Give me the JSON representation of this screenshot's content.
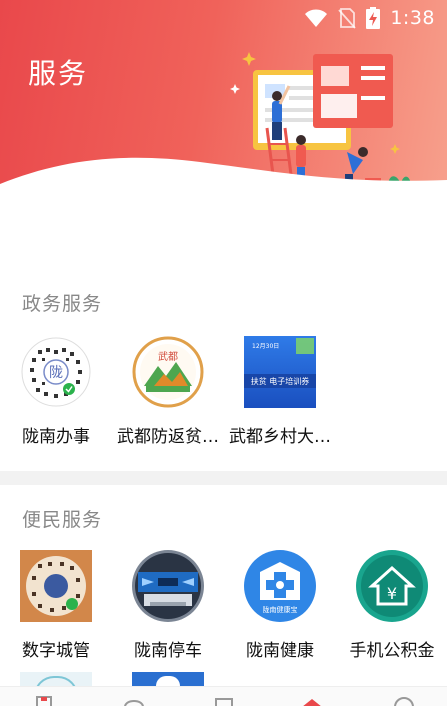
{
  "status_bar": {
    "time": "1:38"
  },
  "header": {
    "title": "服务"
  },
  "sections": [
    {
      "title": "政务服务",
      "items": [
        {
          "label": "陇南办事",
          "icon": "qr-code-icon"
        },
        {
          "label": "武都防返贫…",
          "icon": "mountain-logo-icon",
          "badge": "武都"
        },
        {
          "label": "武都乡村大…",
          "icon": "training-banner-icon",
          "banner_text": "扶贫 电子培训券",
          "banner_date": "12月30日"
        }
      ]
    },
    {
      "title": "便民服务",
      "items": [
        {
          "label": "数字城管",
          "icon": "qr-code-orange-icon"
        },
        {
          "label": "陇南停车",
          "icon": "parking-icon"
        },
        {
          "label": "陇南健康",
          "icon": "health-icon",
          "caption": "陇南健康宝"
        },
        {
          "label": "手机公积金",
          "icon": "housing-fund-icon",
          "symbol": "¥"
        }
      ]
    }
  ],
  "colors": {
    "accent": "#e9484b",
    "section_title": "#888888",
    "divider": "#f2f2f2"
  }
}
